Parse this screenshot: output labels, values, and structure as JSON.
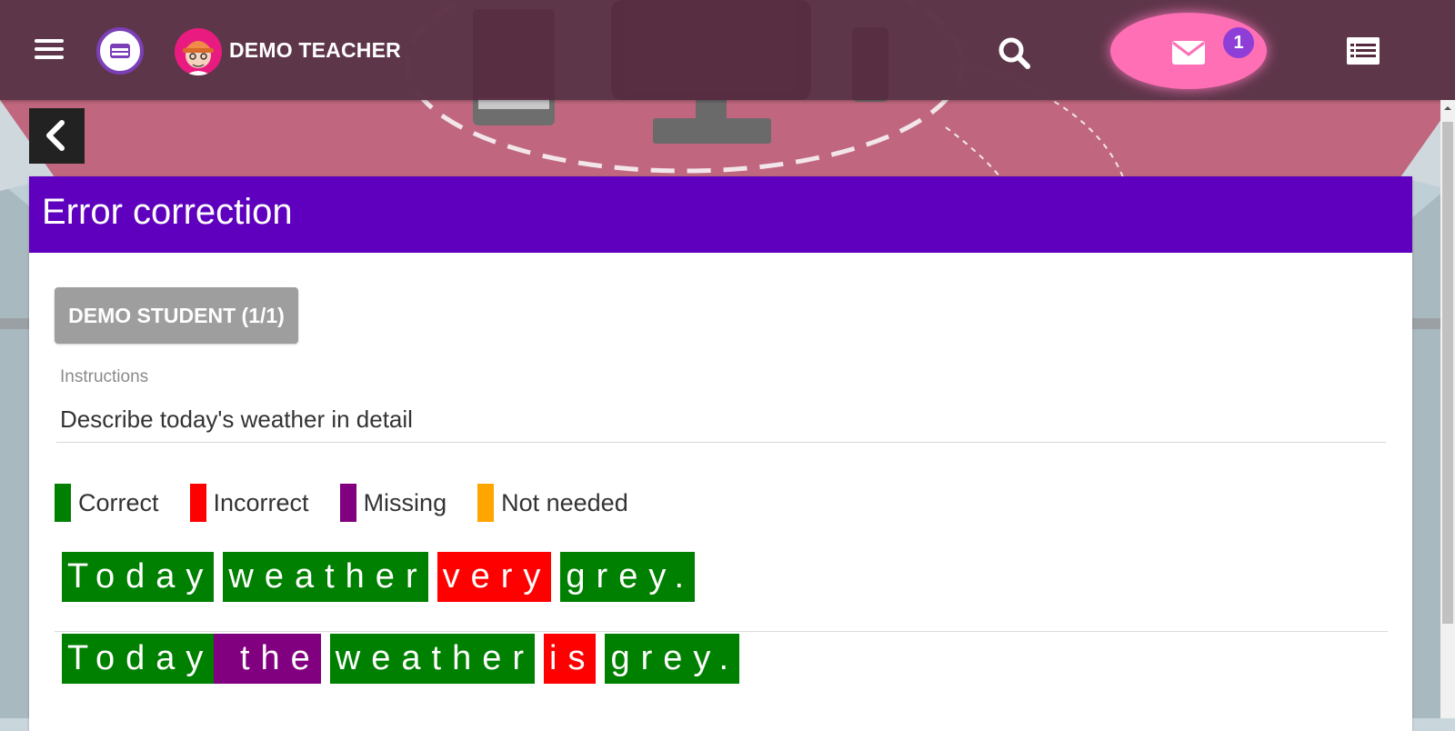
{
  "header": {
    "user_name": "DEMO TEACHER",
    "notification_count": "1"
  },
  "icons": {
    "menu": "menu-icon",
    "logo": "app-logo",
    "avatar": "teacher-avatar",
    "search": "search-icon",
    "mail": "envelope-icon",
    "list": "list-icon",
    "back": "chevron-left-icon"
  },
  "card": {
    "title": "Error correction",
    "student_button": "DEMO STUDENT (1/1)",
    "instructions_label": "Instructions",
    "instructions_value": "Describe today's weather in detail"
  },
  "legend": [
    {
      "label": "Correct",
      "color": "#008000"
    },
    {
      "label": "Incorrect",
      "color": "#ff0000"
    },
    {
      "label": "Missing",
      "color": "#800080"
    },
    {
      "label": "Not needed",
      "color": "#ffa500"
    }
  ],
  "sentences": {
    "student": [
      {
        "text": "Today",
        "status": "correct"
      },
      {
        "text": "weather",
        "status": "correct"
      },
      {
        "text": "very",
        "status": "incorrect"
      },
      {
        "text": "grey.",
        "status": "correct"
      }
    ],
    "corrected": [
      {
        "text": "Today",
        "status": "correct"
      },
      {
        "text": " the",
        "status": "missing"
      },
      {
        "text": "weather",
        "status": "correct"
      },
      {
        "text": "is",
        "status": "incorrect"
      },
      {
        "text": "grey.",
        "status": "correct"
      }
    ]
  },
  "colors": {
    "topbar": "#562a3e",
    "card_header": "#5e00bd",
    "mail_button": "#ff6fb5",
    "badge": "#8e3ed6",
    "correct": "#008000",
    "incorrect": "#ff0000",
    "missing": "#800080",
    "not_needed": "#ffa500"
  }
}
